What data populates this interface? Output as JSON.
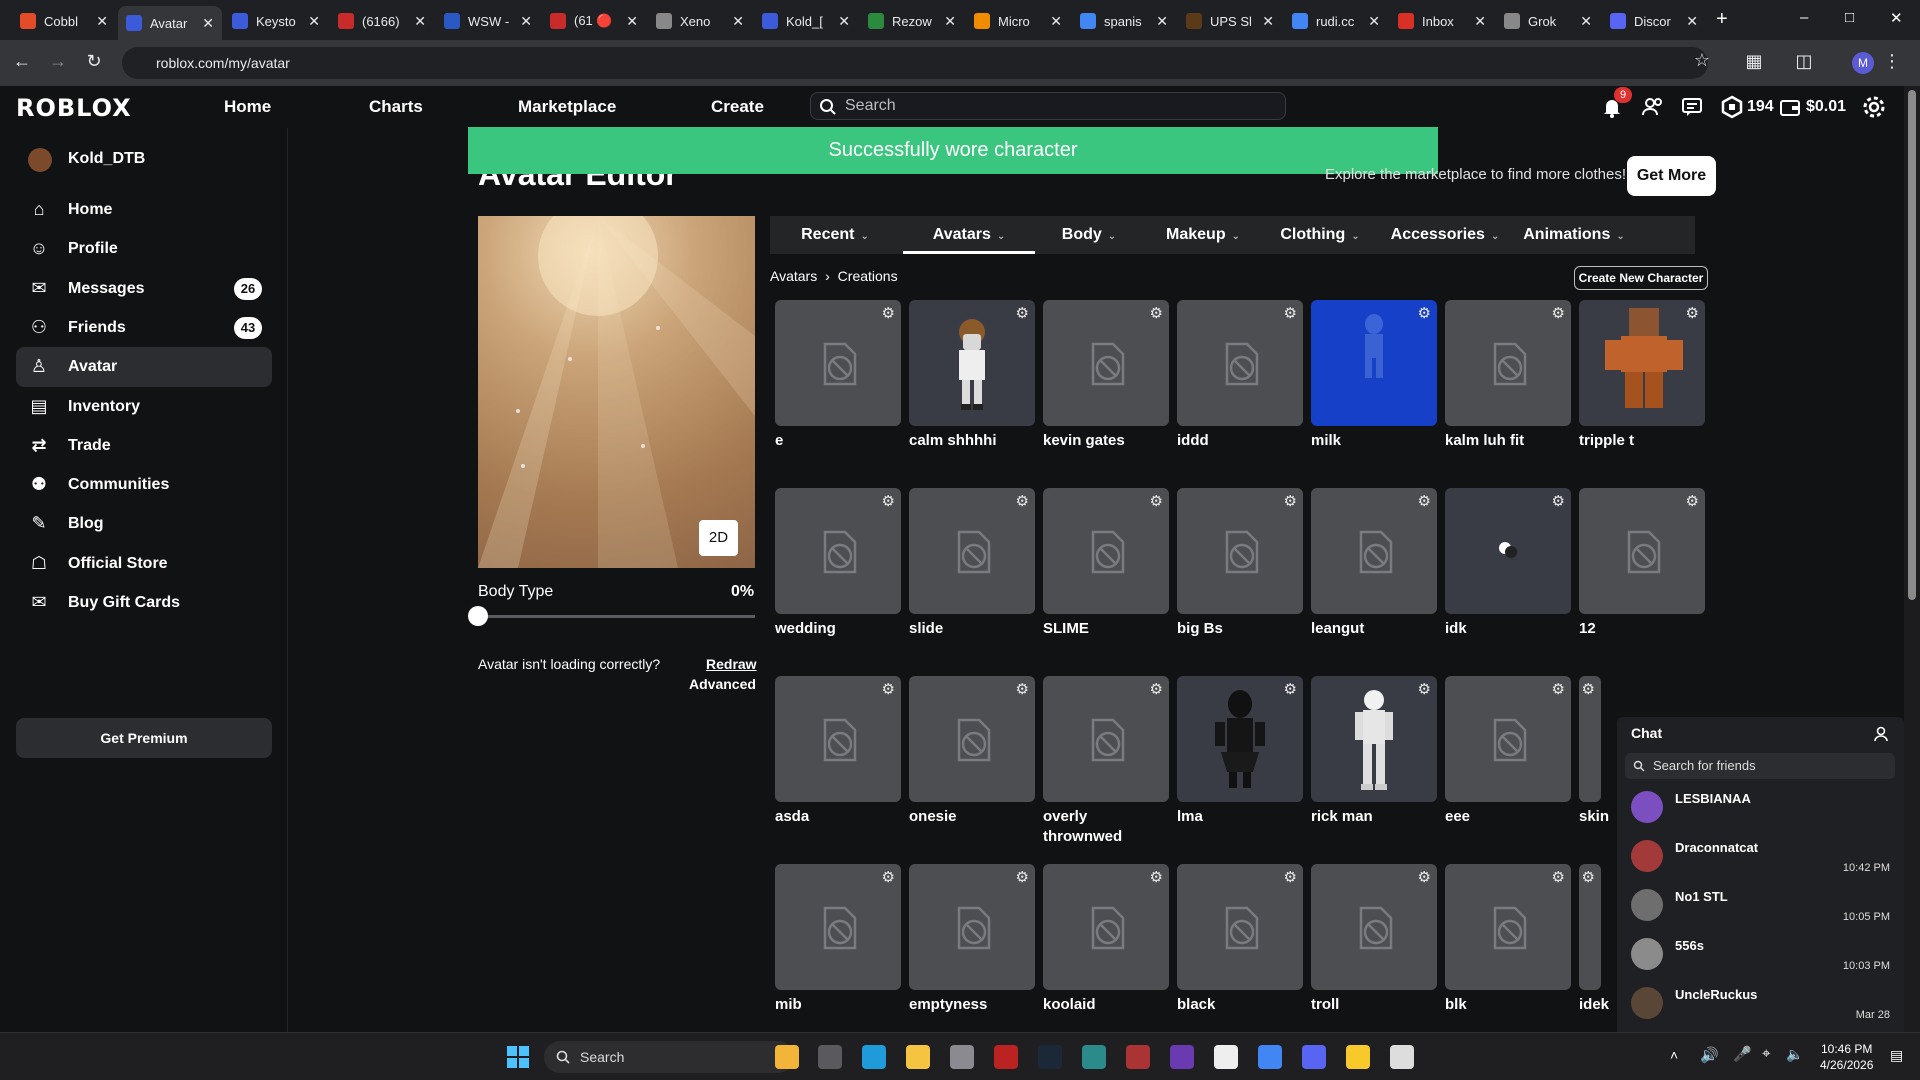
{
  "browser": {
    "tabs": [
      {
        "title": "Cobbl",
        "color": "#e34c26"
      },
      {
        "title": "Avatar",
        "color": "#3b5bdb",
        "active": true
      },
      {
        "title": "Keysto",
        "color": "#3b5bdb"
      },
      {
        "title": "(6166)",
        "color": "#c92a2a"
      },
      {
        "title": "WSW -",
        "color": "#2b59c3"
      },
      {
        "title": "(61 🔴",
        "color": "#c92a2a"
      },
      {
        "title": "Xeno",
        "color": "#888888"
      },
      {
        "title": "Kold_[",
        "color": "#3b5bdb"
      },
      {
        "title": "Rezow",
        "color": "#2b8a3e"
      },
      {
        "title": "Micro",
        "color": "#f08c00"
      },
      {
        "title": "spanis",
        "color": "#4285f4"
      },
      {
        "title": "UPS Sl",
        "color": "#5b3a1a"
      },
      {
        "title": "rudi.cc",
        "color": "#4285f4"
      },
      {
        "title": "Inbox",
        "color": "#d93025"
      },
      {
        "title": "Grok",
        "color": "#888888"
      },
      {
        "title": "Discor",
        "color": "#5865f2"
      }
    ],
    "url": "roblox.com/my/avatar",
    "profile_initial": "M"
  },
  "header": {
    "logo": "ROBLOX",
    "nav": [
      "Home",
      "Charts",
      "Marketplace",
      "Create"
    ],
    "search_placeholder": "Search",
    "notif_count": "9",
    "robux": "194",
    "balance": "$0.01"
  },
  "sidebar": {
    "username": "Kold_DTB",
    "items": [
      {
        "label": "Home",
        "icon": "home-icon"
      },
      {
        "label": "Profile",
        "icon": "profile-icon"
      },
      {
        "label": "Messages",
        "icon": "messages-icon",
        "badge": "26"
      },
      {
        "label": "Friends",
        "icon": "friends-icon",
        "badge": "43"
      },
      {
        "label": "Avatar",
        "icon": "avatar-icon",
        "active": true
      },
      {
        "label": "Inventory",
        "icon": "inventory-icon"
      },
      {
        "label": "Trade",
        "icon": "trade-icon"
      },
      {
        "label": "Communities",
        "icon": "communities-icon"
      },
      {
        "label": "Blog",
        "icon": "blog-icon"
      },
      {
        "label": "Official Store",
        "icon": "store-icon"
      },
      {
        "label": "Buy Gift Cards",
        "icon": "gift-card-icon"
      }
    ],
    "premium": "Get Premium"
  },
  "main": {
    "toast": "Successfully wore character",
    "title": "Avatar Editor",
    "explore": "Explore the marketplace to find more clothes!",
    "get_more": "Get More",
    "btn_2d": "2D",
    "body_type_label": "Body Type",
    "body_type_value": "0%",
    "body_type_level": 0,
    "loading_question": "Avatar isn't loading correctly?",
    "redraw": "Redraw",
    "advanced": "Advanced",
    "tabs": [
      "Recent",
      "Avatars",
      "Body",
      "Makeup",
      "Clothing",
      "Accessories",
      "Animations"
    ],
    "active_tab": "Avatars",
    "breadcrumb": [
      "Avatars",
      "Creations"
    ],
    "create_new": "Create New Character",
    "items": [
      {
        "name": "e",
        "thumb": "placeholder"
      },
      {
        "name": "calm shhhhi",
        "thumb": "figure"
      },
      {
        "name": "kevin gates",
        "thumb": "placeholder"
      },
      {
        "name": "iddd",
        "thumb": "placeholder"
      },
      {
        "name": "milk",
        "thumb": "blue"
      },
      {
        "name": "kalm luh fit",
        "thumb": "placeholder"
      },
      {
        "name": "tripple t",
        "thumb": "blocky"
      },
      {
        "name": "wedding",
        "thumb": "placeholder"
      },
      {
        "name": "slide",
        "thumb": "placeholder"
      },
      {
        "name": "SLIME",
        "thumb": "placeholder"
      },
      {
        "name": "big Bs",
        "thumb": "placeholder"
      },
      {
        "name": "leangut",
        "thumb": "placeholder"
      },
      {
        "name": "idk",
        "thumb": "small"
      },
      {
        "name": "12",
        "thumb": "placeholder"
      },
      {
        "name": "asda",
        "thumb": "placeholder"
      },
      {
        "name": "onesie",
        "thumb": "placeholder"
      },
      {
        "name": "overly thrownwed",
        "thumb": "placeholder"
      },
      {
        "name": "lma",
        "thumb": "black"
      },
      {
        "name": "rick man",
        "thumb": "white"
      },
      {
        "name": "eee",
        "thumb": "placeholder"
      },
      {
        "name": "skin w",
        "thumb": "placeholder"
      },
      {
        "name": "mib",
        "thumb": "placeholder"
      },
      {
        "name": "emptyness",
        "thumb": "placeholder"
      },
      {
        "name": "koolaid",
        "thumb": "placeholder"
      },
      {
        "name": "black",
        "thumb": "placeholder"
      },
      {
        "name": "troll",
        "thumb": "placeholder"
      },
      {
        "name": "blk",
        "thumb": "placeholder"
      },
      {
        "name": "idek",
        "thumb": "placeholder"
      }
    ]
  },
  "chat": {
    "title": "Chat",
    "search_placeholder": "Search for friends",
    "conversations": [
      {
        "name": "LESBIANAA",
        "time": ""
      },
      {
        "name": "Draconnatcat",
        "time": "10:42 PM"
      },
      {
        "name": "No1 STL",
        "time": "10:05 PM"
      },
      {
        "name": "556s",
        "time": "10:03 PM"
      },
      {
        "name": "UncleRuckus",
        "time": "Mar 28"
      }
    ]
  },
  "taskbar": {
    "search_placeholder": "Search",
    "time": "10:46 PM",
    "date": "4/26/2026"
  }
}
